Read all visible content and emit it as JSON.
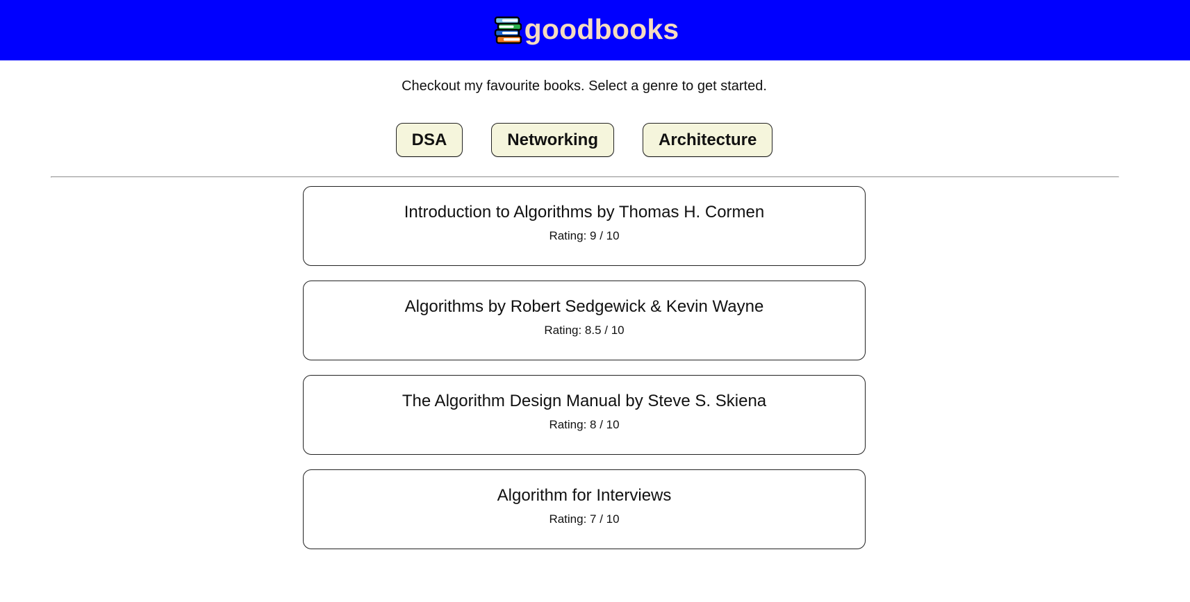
{
  "header": {
    "brand_name": "goodbooks",
    "logo_icon": "books-stack-icon",
    "background_color": "#0000ff",
    "brand_color": "#f5dcc0"
  },
  "main": {
    "tagline": "Checkout my favourite books. Select a genre to get started.",
    "genres": [
      {
        "label": "DSA"
      },
      {
        "label": "Networking"
      },
      {
        "label": "Architecture"
      }
    ],
    "selected_genre": "DSA",
    "button_color": "#f5f5dc",
    "books": [
      {
        "title": "Introduction to Algorithms by Thomas H. Cormen",
        "rating": "Rating: 9 / 10"
      },
      {
        "title": "Algorithms by Robert Sedgewick & Kevin Wayne",
        "rating": "Rating: 8.5 / 10"
      },
      {
        "title": "The Algorithm Design Manual by Steve S. Skiena",
        "rating": "Rating: 8 / 10"
      },
      {
        "title": "Algorithm for Interviews",
        "rating": "Rating: 7 / 10"
      }
    ]
  }
}
